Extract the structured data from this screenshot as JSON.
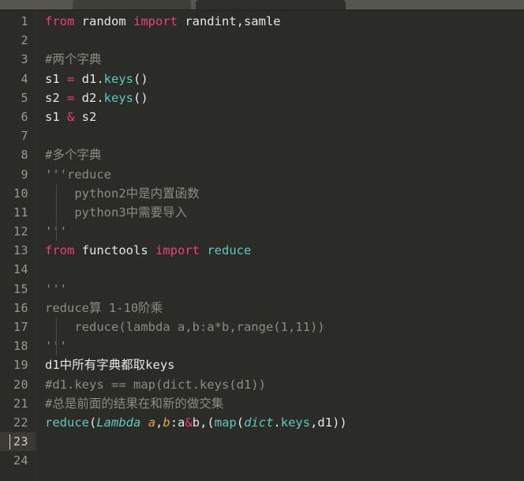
{
  "window": {
    "app": "code-editor",
    "theme_background": "#2b2b28",
    "gutter_color": "#2b2b28",
    "active_line_color": "#3a3a33"
  },
  "tabbar": {
    "tabs": [
      {
        "label": ""
      },
      {
        "label": ""
      }
    ]
  },
  "editor": {
    "total_lines": 24,
    "active_line": 23,
    "caret": {
      "line": 23,
      "column": 1
    },
    "palette": {
      "keyword": "#ec407a",
      "comment": "#8c8c80",
      "function": "#5fc9c0",
      "operator": "#ec407a",
      "string": "#8c8c80",
      "parameter": "#e8a33d",
      "plain": "#e6e6e6"
    },
    "lines": [
      {
        "n": "1",
        "text": "from random import randint,samle"
      },
      {
        "n": "2",
        "text": ""
      },
      {
        "n": "3",
        "text": "#两个字典"
      },
      {
        "n": "4",
        "text": "s1 = d1.keys()"
      },
      {
        "n": "5",
        "text": "s2 = d2.keys()"
      },
      {
        "n": "6",
        "text": "s1 & s2"
      },
      {
        "n": "7",
        "text": ""
      },
      {
        "n": "8",
        "text": "#多个字典"
      },
      {
        "n": "9",
        "text": "'''reduce"
      },
      {
        "n": "10",
        "text": "    python2中是内置函数"
      },
      {
        "n": "11",
        "text": "    python3中需要导入"
      },
      {
        "n": "12",
        "text": "'''"
      },
      {
        "n": "13",
        "text": "from functools import reduce"
      },
      {
        "n": "14",
        "text": ""
      },
      {
        "n": "15",
        "text": "'''"
      },
      {
        "n": "16",
        "text": "reduce算 1-10阶乘"
      },
      {
        "n": "17",
        "text": "    reduce(lambda a,b:a*b,range(1,11))"
      },
      {
        "n": "18",
        "text": "'''"
      },
      {
        "n": "19",
        "text": "d1中所有字典都取keys"
      },
      {
        "n": "20",
        "text": "#d1.keys == map(dict.keys(d1))"
      },
      {
        "n": "21",
        "text": "#总是前面的结果在和新的做交集"
      },
      {
        "n": "22",
        "text": "reduce(Lambda a,b:a&b,(map(dict.keys,d1))"
      },
      {
        "n": "23",
        "text": ""
      },
      {
        "n": "24",
        "text": ""
      }
    ],
    "tokens": {
      "l1": [
        {
          "t": "from",
          "c": "kw"
        },
        {
          "t": " random ",
          "c": "pl"
        },
        {
          "t": "import",
          "c": "kw"
        },
        {
          "t": " randint,samle",
          "c": "pl"
        }
      ],
      "l3": [
        {
          "t": "#两个字典",
          "c": "com"
        }
      ],
      "l4": [
        {
          "t": "s1 ",
          "c": "pl"
        },
        {
          "t": "=",
          "c": "op"
        },
        {
          "t": " d1.",
          "c": "pl"
        },
        {
          "t": "keys",
          "c": "fn"
        },
        {
          "t": "()",
          "c": "pl"
        }
      ],
      "l5": [
        {
          "t": "s2 ",
          "c": "pl"
        },
        {
          "t": "=",
          "c": "op"
        },
        {
          "t": " d2.",
          "c": "pl"
        },
        {
          "t": "keys",
          "c": "fn"
        },
        {
          "t": "()",
          "c": "pl"
        }
      ],
      "l6": [
        {
          "t": "s1 ",
          "c": "pl"
        },
        {
          "t": "&",
          "c": "op"
        },
        {
          "t": " s2",
          "c": "pl"
        }
      ],
      "l8": [
        {
          "t": "#多个字典",
          "c": "com"
        }
      ],
      "l9": [
        {
          "t": "'''reduce",
          "c": "str"
        }
      ],
      "l10": [
        {
          "t": "    python2中是内置函数",
          "c": "str"
        }
      ],
      "l11": [
        {
          "t": "    python3中需要导入",
          "c": "str"
        }
      ],
      "l12": [
        {
          "t": "'''",
          "c": "str"
        }
      ],
      "l13": [
        {
          "t": "from",
          "c": "kw"
        },
        {
          "t": " functools ",
          "c": "pl"
        },
        {
          "t": "import",
          "c": "kw"
        },
        {
          "t": " ",
          "c": "pl"
        },
        {
          "t": "reduce",
          "c": "fn"
        }
      ],
      "l15": [
        {
          "t": "'''",
          "c": "str"
        }
      ],
      "l16": [
        {
          "t": "reduce算 1-10阶乘",
          "c": "str"
        }
      ],
      "l17": [
        {
          "t": "    reduce(lambda a,b:a*b,range(1,11))",
          "c": "str"
        }
      ],
      "l18": [
        {
          "t": "'''",
          "c": "str"
        }
      ],
      "l19": [
        {
          "t": "d1中所有字典都取keys",
          "c": "pl"
        }
      ],
      "l20": [
        {
          "t": "#d1.keys == map(dict.keys(d1))",
          "c": "com"
        }
      ],
      "l21": [
        {
          "t": "#总是前面的结果在和新的做交集",
          "c": "com"
        }
      ],
      "l22": [
        {
          "t": "reduce",
          "c": "fn"
        },
        {
          "t": "(",
          "c": "pl"
        },
        {
          "t": "Lambda",
          "c": "lam"
        },
        {
          "t": " ",
          "c": "pl"
        },
        {
          "t": "a",
          "c": "param"
        },
        {
          "t": ",",
          "c": "pl"
        },
        {
          "t": "b",
          "c": "param"
        },
        {
          "t": ":a",
          "c": "pl"
        },
        {
          "t": "&",
          "c": "op"
        },
        {
          "t": "b,(",
          "c": "pl"
        },
        {
          "t": "map",
          "c": "fn"
        },
        {
          "t": "(",
          "c": "pl"
        },
        {
          "t": "dict",
          "c": "cls"
        },
        {
          "t": ".",
          "c": "pl"
        },
        {
          "t": "keys",
          "c": "fn"
        },
        {
          "t": ",d1))",
          "c": "pl"
        }
      ]
    }
  }
}
